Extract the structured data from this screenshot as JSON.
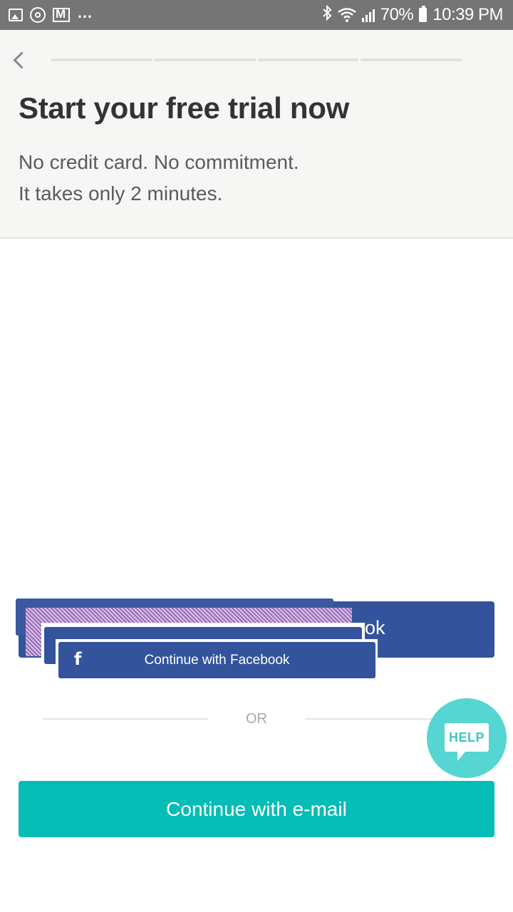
{
  "status_bar": {
    "battery": "70%",
    "time": "10:39 PM",
    "more_glyph": "…",
    "icons": [
      "image-icon",
      "power-icon",
      "mail-icon",
      "more-icon",
      "bluetooth-icon",
      "wifi-icon",
      "signal-icon",
      "battery-icon"
    ]
  },
  "header": {
    "title": "Start your free trial now",
    "subtitle_line1": "No credit card. No commitment.",
    "subtitle_line2": "It takes only 2 minutes.",
    "progress_steps": 4
  },
  "facebook": {
    "label": "Continue with Facebook",
    "icon_glyph": "f",
    "ghost_text_fragment": "ok",
    "color": "#33549c"
  },
  "divider": {
    "label": "OR"
  },
  "email": {
    "label": "Continue with e-mail",
    "color": "#05bdb7"
  },
  "help": {
    "label": "HELP",
    "color": "#55d6d2"
  }
}
